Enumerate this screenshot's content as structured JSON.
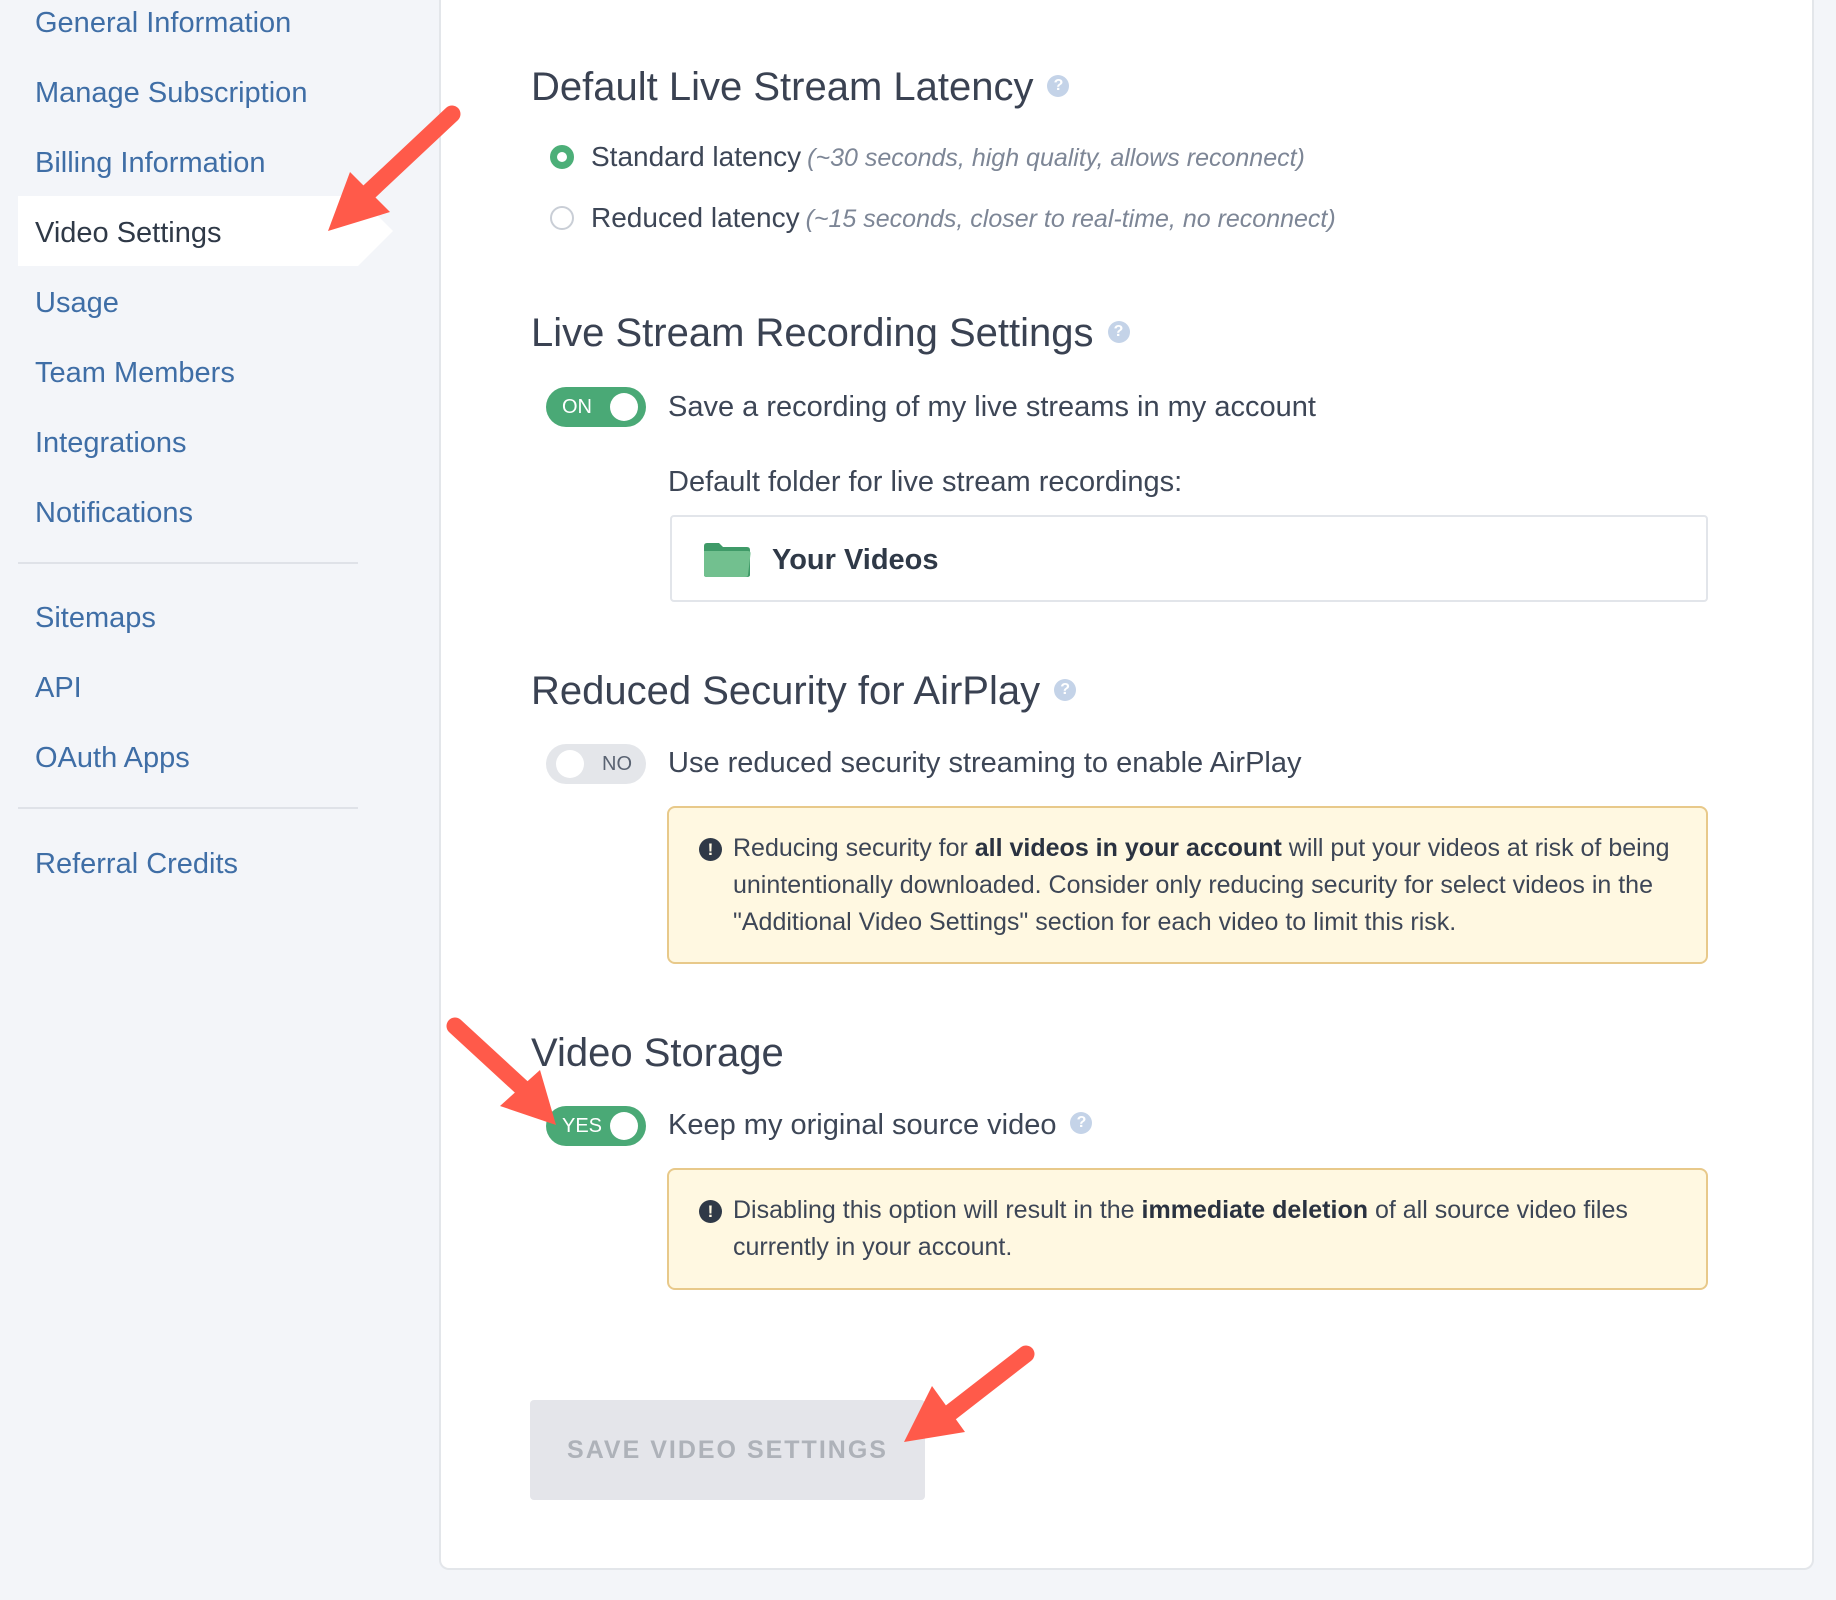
{
  "sidebar": {
    "items": [
      {
        "label": "General Information"
      },
      {
        "label": "Manage Subscription"
      },
      {
        "label": "Billing Information"
      },
      {
        "label": "Video Settings",
        "active": true
      },
      {
        "label": "Usage"
      },
      {
        "label": "Team Members"
      },
      {
        "label": "Integrations"
      },
      {
        "label": "Notifications"
      },
      {
        "label": "Sitemaps"
      },
      {
        "label": "API"
      },
      {
        "label": "OAuth Apps"
      },
      {
        "label": "Referral Credits"
      }
    ]
  },
  "latency": {
    "title": "Default Live Stream Latency",
    "help_icon": "question-circle-icon",
    "options": [
      {
        "label": "Standard latency",
        "hint": "(~30 seconds, high quality, allows reconnect)",
        "selected": true
      },
      {
        "label": "Reduced latency",
        "hint": "(~15 seconds, closer to real-time, no reconnect)",
        "selected": false
      }
    ]
  },
  "recording": {
    "title": "Live Stream Recording Settings",
    "toggle_label": "ON",
    "toggle_state": true,
    "description": "Save a recording of my live streams in my account",
    "folder_label": "Default folder for live stream recordings:",
    "folder_name": "Your Videos",
    "folder_icon": "folder-icon"
  },
  "airplay": {
    "title": "Reduced Security for AirPlay",
    "toggle_label": "NO",
    "toggle_state": false,
    "description": "Use reduced security streaming to enable AirPlay",
    "warning": {
      "icon": "!",
      "before": "Reducing security for ",
      "bold": "all videos in your account",
      "after": " will put your videos at risk of being unintentionally downloaded. Consider only reducing security for select videos in the \"Additional Video Settings\" section for each video to limit this risk."
    }
  },
  "storage": {
    "title": "Video Storage",
    "toggle_label": "YES",
    "toggle_state": true,
    "description": "Keep my original source video",
    "warning": {
      "icon": "!",
      "before": "Disabling this option will result in the ",
      "bold": "immediate deletion",
      "after": " of all source video files currently in your account."
    }
  },
  "actions": {
    "save_label": "SAVE VIDEO SETTINGS"
  },
  "help_glyph": "?",
  "colors": {
    "accent_green": "#4aa976",
    "link_blue": "#3f6ea6",
    "annotation_red": "#ff5a4a",
    "warning_bg": "#fff8e1",
    "warning_border": "#e8c98a"
  }
}
